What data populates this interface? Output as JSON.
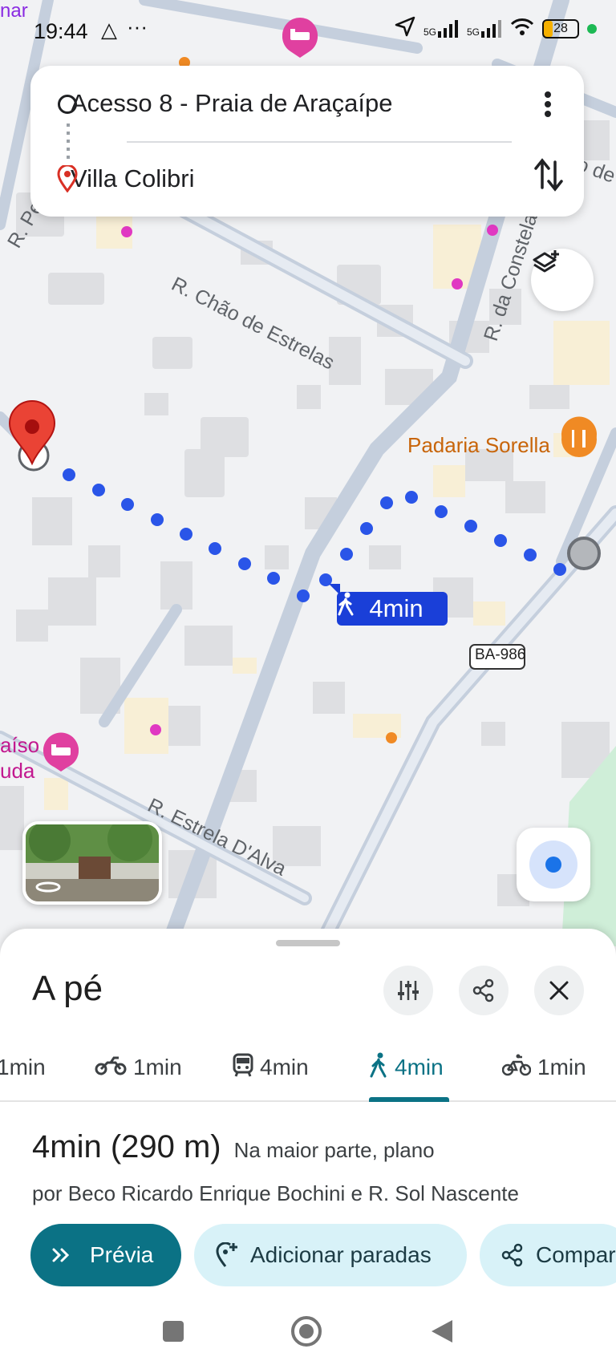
{
  "status_bar": {
    "time": "19:44",
    "ellipsis": "···",
    "signal1": "5G",
    "signal2": "5G",
    "battery": "28"
  },
  "top_left_fragment": "nar",
  "route": {
    "origin": "Acesso 8 - Praia de Araçaípe",
    "destination": "Villa Colibri"
  },
  "map": {
    "streets": [
      "R. Chão de Estrelas",
      "R. da Constela",
      "R. Estrela D'Alva",
      "R. Pe",
      "ão de"
    ],
    "highway_shield": "BA-986",
    "pois": [
      {
        "name": "Padaria Sorella",
        "color": "#c8650a",
        "icon": "bakery-icon"
      },
      {
        "name_line1": "aíso",
        "name_line2": "uda",
        "color": "#c2188f",
        "icon": "hotel-icon"
      }
    ],
    "route_chip": "4min",
    "route_color": "#1a3fd8"
  },
  "sheet": {
    "title": "A pé",
    "modes": [
      {
        "icon": "car-icon",
        "label": "1min"
      },
      {
        "icon": "motorcycle-icon",
        "label": "1min"
      },
      {
        "icon": "transit-icon",
        "label": "4min"
      },
      {
        "icon": "walk-icon",
        "label": "4min",
        "active": true
      },
      {
        "icon": "bike-icon",
        "label": "1min"
      }
    ],
    "summary_time": "4min (290 m)",
    "summary_note": "Na maior parte, plano",
    "via": "por Beco Ricardo Enrique Bochini e R. Sol Nascente",
    "actions": {
      "preview": "Prévia",
      "add_stops": "Adicionar paradas",
      "share": "Compar"
    }
  },
  "colors": {
    "accent": "#0b7285",
    "accent_light": "#d8f2f8",
    "route_blue": "#1a3fd8"
  }
}
